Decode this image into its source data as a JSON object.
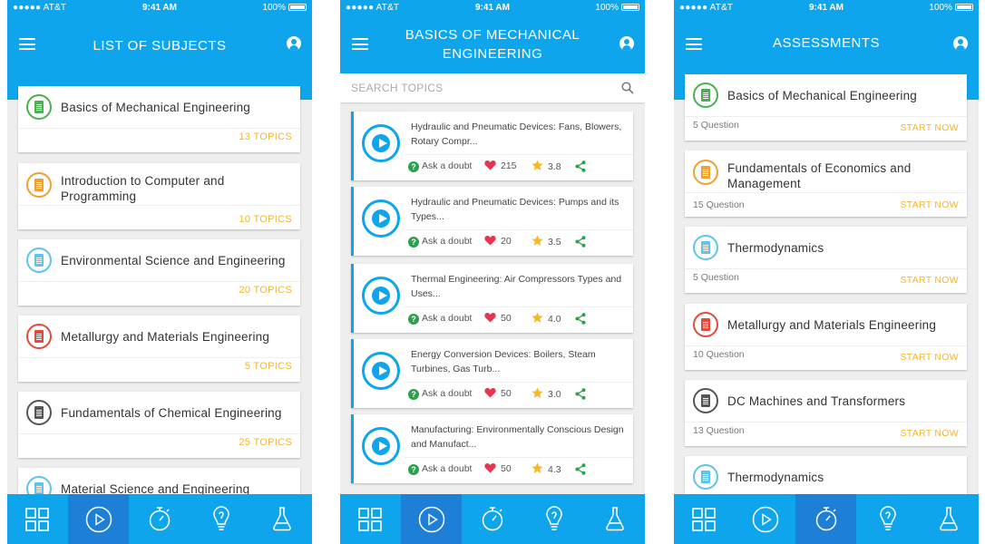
{
  "status_bar": {
    "carrier": "●●●●● AT&T",
    "time": "9:41 AM",
    "battery": "100%"
  },
  "colors": {
    "primary": "#0ea5ec",
    "nav_active": "#1e7fd6",
    "accent": "#f2b632",
    "green": "#4caf50",
    "orange": "#f0a030",
    "lightblue": "#5fc4e8",
    "red": "#e04b3c",
    "dark": "#555555"
  },
  "screen1": {
    "title": "LIST OF SUBJECTS",
    "subjects": [
      {
        "name": "Basics of Mechanical Engineering",
        "topics": "13 TOPICS",
        "icon_color": "green"
      },
      {
        "name": "Introduction to Computer and Programming",
        "topics": "10 TOPICS",
        "icon_color": "orange"
      },
      {
        "name": "Environmental Science and Engineering",
        "topics": "20 TOPICS",
        "icon_color": "lightblue"
      },
      {
        "name": "Metallurgy and Materials Engineering",
        "topics": "5 TOPICS",
        "icon_color": "red"
      },
      {
        "name": "Fundamentals of Chemical Engineering",
        "topics": "25 TOPICS",
        "icon_color": "dark"
      },
      {
        "name": "Material Science and Engineering",
        "topics": "",
        "icon_color": "lightblue"
      }
    ]
  },
  "screen2": {
    "title": "BASICS OF MECHANICAL ENGINEERING",
    "search_placeholder": "SEARCH TOPICS",
    "videos": [
      {
        "title": "Hydraulic and Pneumatic Devices: Fans, Blowers, Rotary Compr...",
        "ask": "Ask a doubt",
        "likes": "215",
        "rating": "3.8"
      },
      {
        "title": "Hydraulic and Pneumatic Devices: Pumps and its Types...",
        "ask": "Ask a doubt",
        "likes": "20",
        "rating": "3.5"
      },
      {
        "title": "Thermal Engineering: Air Compressors Types and Uses...",
        "ask": "Ask a doubt",
        "likes": "50",
        "rating": "4.0"
      },
      {
        "title": "Energy Conversion Devices: Boilers, Steam Turbines, Gas Turb...",
        "ask": "Ask a doubt",
        "likes": "50",
        "rating": "3.0"
      },
      {
        "title": "Manufacturing: Environmentally Conscious Design and Manufact...",
        "ask": "Ask a doubt",
        "likes": "50",
        "rating": "4.3"
      }
    ]
  },
  "screen3": {
    "title": "ASSESSMENTS",
    "assessments": [
      {
        "name": "Basics of Mechanical Engineering",
        "questions": "5 Question",
        "action": "START NOW",
        "icon_color": "green"
      },
      {
        "name": "Fundamentals of Economics and Management",
        "questions": "15 Question",
        "action": "START NOW",
        "icon_color": "orange"
      },
      {
        "name": "Thermodynamics",
        "questions": "5 Question",
        "action": "START NOW",
        "icon_color": "lightblue"
      },
      {
        "name": "Metallurgy and Materials Engineering",
        "questions": "10 Question",
        "action": "START NOW",
        "icon_color": "red"
      },
      {
        "name": "DC Machines and Transformers",
        "questions": "13 Question",
        "action": "START NOW",
        "icon_color": "dark"
      },
      {
        "name": "Thermodynamics",
        "questions": "",
        "action": "",
        "icon_color": "lightblue"
      }
    ]
  },
  "bottom_nav": {
    "items": [
      {
        "icon": "grid-icon"
      },
      {
        "icon": "play-circle-icon"
      },
      {
        "icon": "stopwatch-icon"
      },
      {
        "icon": "lightbulb-icon"
      },
      {
        "icon": "flask-icon"
      }
    ],
    "active_per_screen": [
      1,
      1,
      2
    ]
  }
}
